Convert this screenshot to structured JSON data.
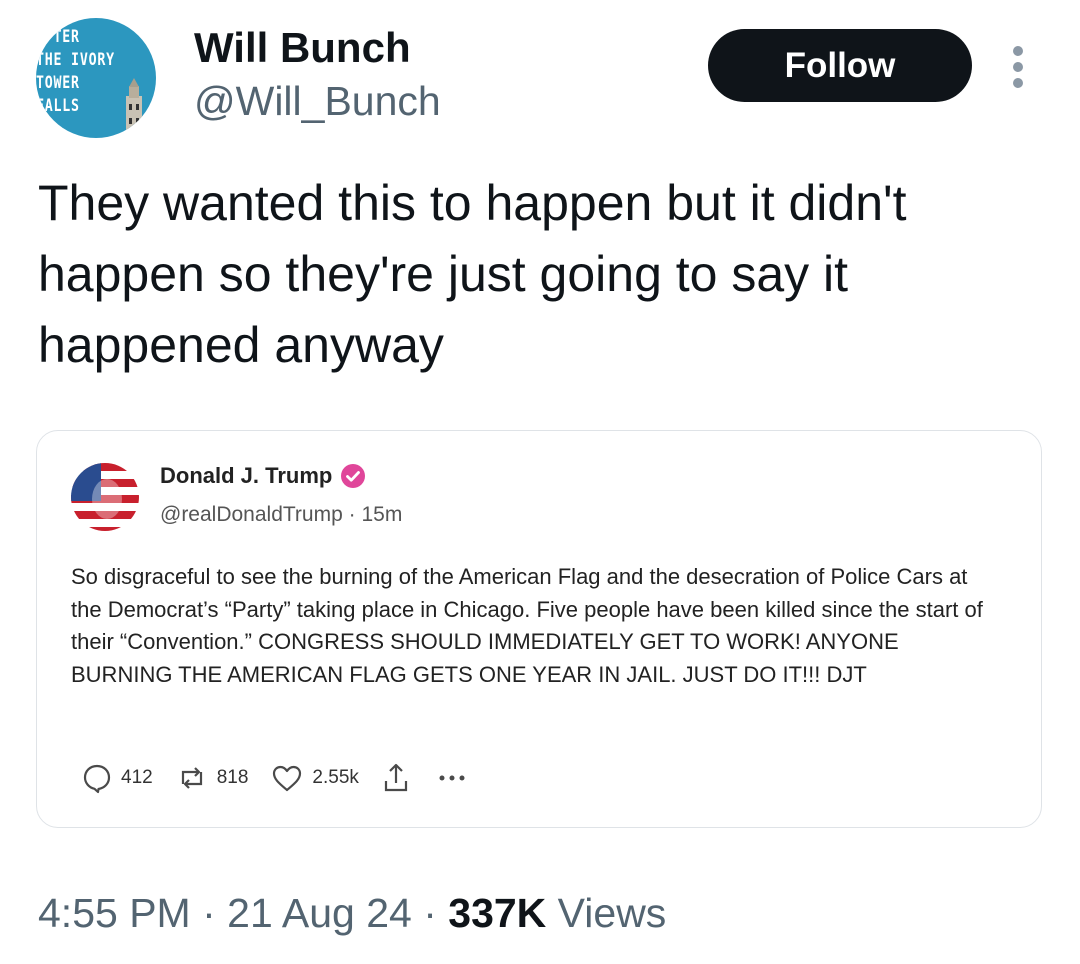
{
  "author": {
    "avatar_text": "AFTER\nTHE IVORY\nTOWER\nFALLS",
    "display_name": "Will Bunch",
    "handle": "@Will_Bunch"
  },
  "follow_label": "Follow",
  "tweet_text": "They wanted this to happen but it didn't happen so they're just going to say it happened anyway",
  "quoted": {
    "display_name": "Donald J. Trump",
    "handle": "@realDonaldTrump",
    "separator": "·",
    "time": "15m",
    "body": "So disgraceful to see the burning of the American Flag and the desecration of Police Cars at the Democrat’s “Party” taking place in Chicago. Five people have been killed since the start of their “Convention.” CONGRESS SHOULD IMMEDIATELY GET TO WORK! ANYONE BURNING THE AMERICAN FLAG GETS ONE YEAR IN JAIL. JUST DO IT!!! DJT",
    "stats": {
      "replies": "412",
      "reposts": "818",
      "likes": "2.55k"
    },
    "verified_color": "#e0469a"
  },
  "footer": {
    "time": "4:55 PM",
    "sep1": " · ",
    "date": "21 Aug 24",
    "sep2": " · ",
    "views_count": "337K",
    "views_label": " Views"
  },
  "icons": [
    "more-vertical-icon",
    "verified-badge-icon",
    "reply-icon",
    "repost-icon",
    "like-icon",
    "share-icon",
    "more-horizontal-icon"
  ]
}
